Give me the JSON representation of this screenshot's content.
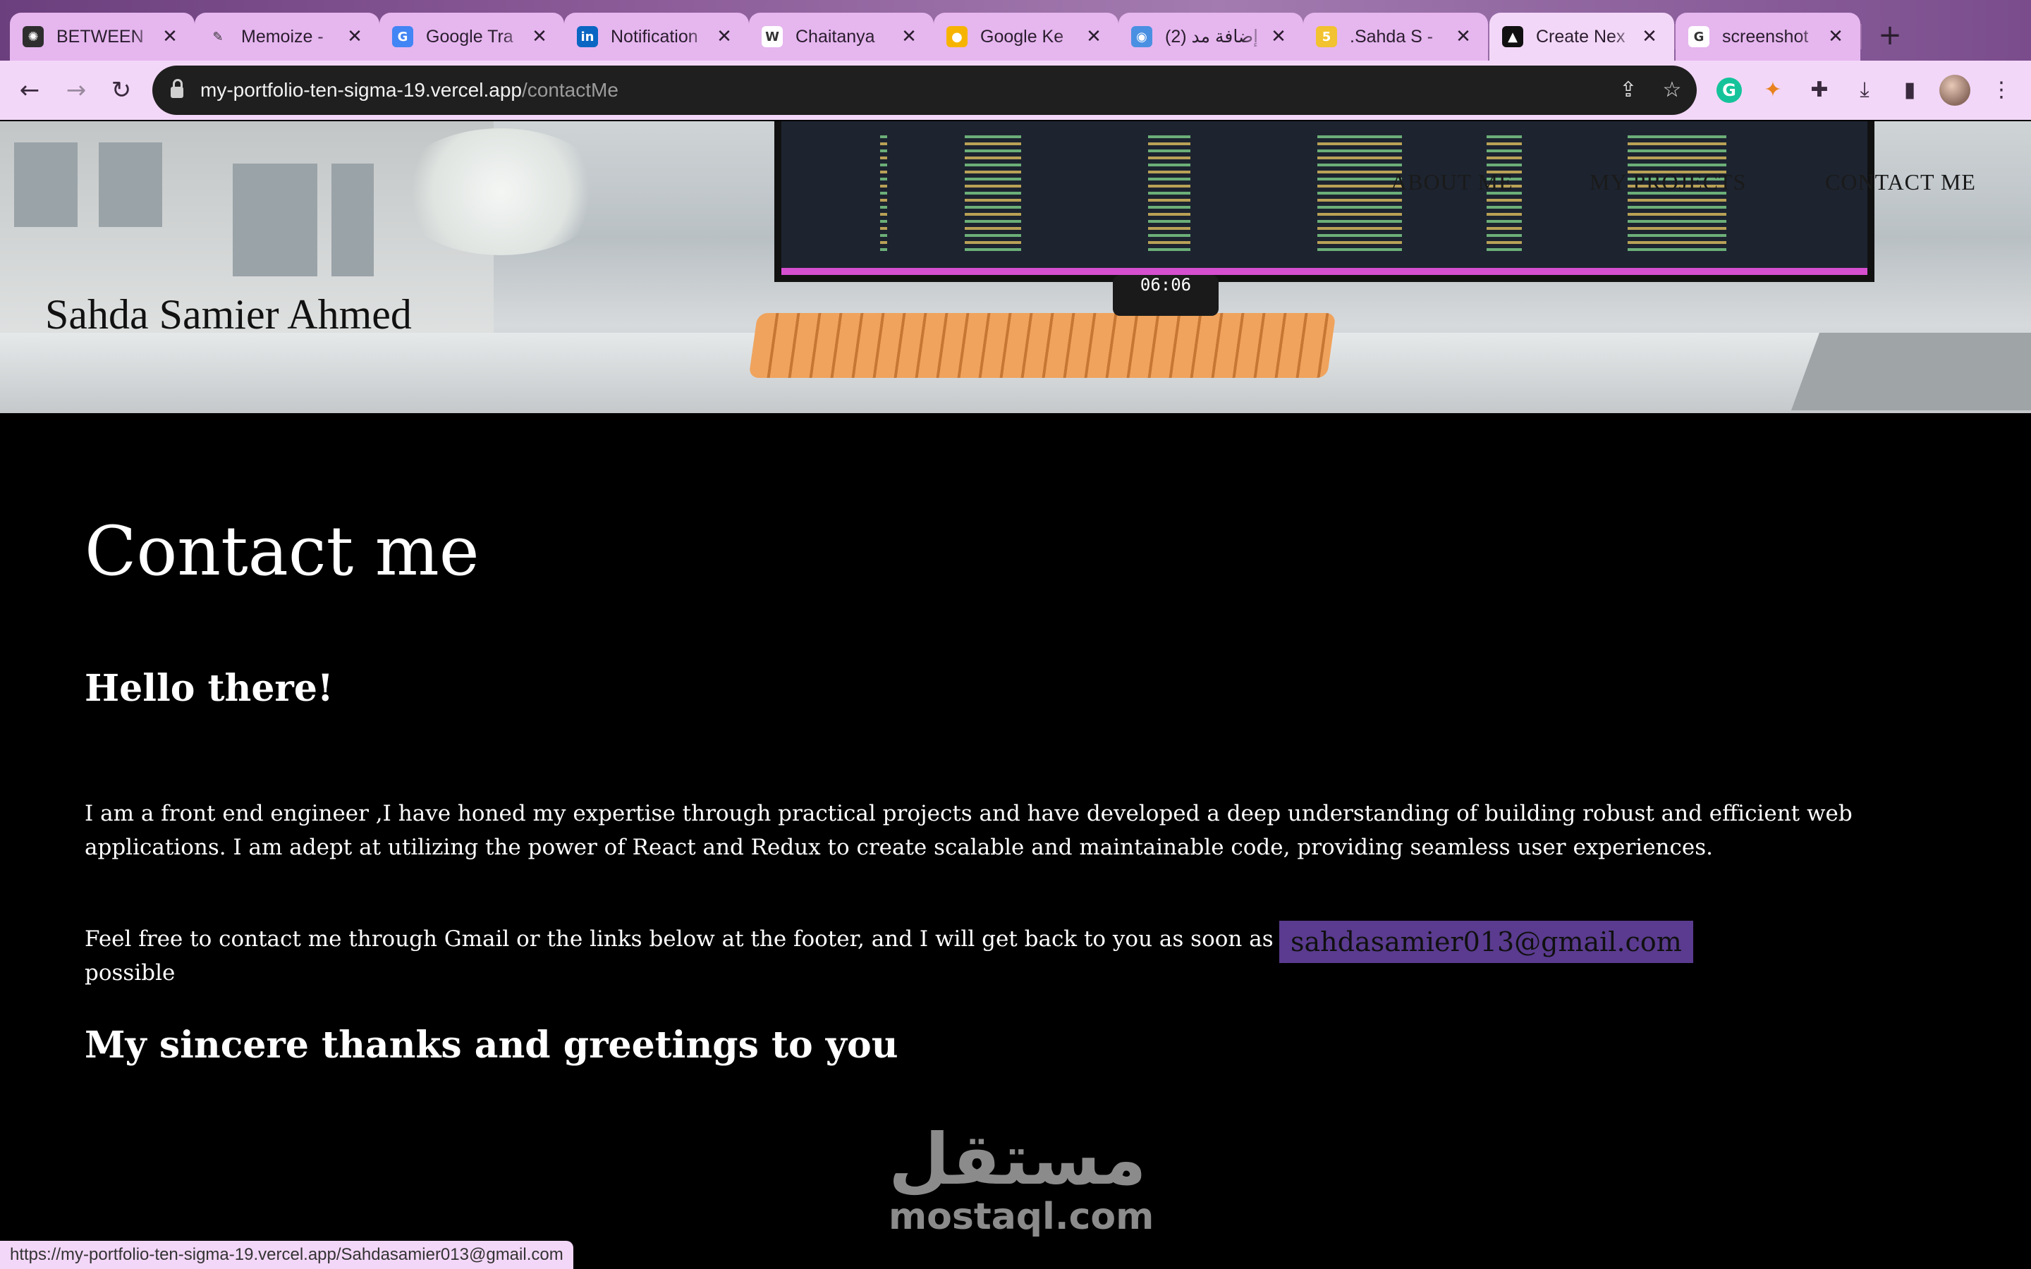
{
  "browser": {
    "tabs": [
      {
        "title": "BETWEEN",
        "favicon": "chatgpt-icon",
        "fav_color": "#2e2e2e",
        "fav_glyph": "✺"
      },
      {
        "title": "Memoize -",
        "favicon": "feather-icon",
        "fav_color": "#e6b6ef",
        "fav_glyph": "✎"
      },
      {
        "title": "Google Tra",
        "favicon": "google-translate-icon",
        "fav_color": "#4285f4",
        "fav_glyph": "G"
      },
      {
        "title": "Notification",
        "favicon": "linkedin-icon",
        "fav_color": "#0a66c2",
        "fav_glyph": "in"
      },
      {
        "title": "Chaitanya",
        "favicon": "wix-icon",
        "fav_color": "#ffffff",
        "fav_glyph": "W"
      },
      {
        "title": "Google Ke",
        "favicon": "google-keep-icon",
        "fav_color": "#f6b400",
        "fav_glyph": "●"
      },
      {
        "title": "(2) إضافة مد",
        "favicon": "mostaql-icon",
        "fav_color": "#4a90e2",
        "fav_glyph": "◉"
      },
      {
        "title": ".Sahda S -",
        "favicon": "number-five-icon",
        "fav_color": "#f2c230",
        "fav_glyph": "5"
      },
      {
        "title": "Create Nex",
        "favicon": "vercel-icon",
        "fav_color": "#111111",
        "fav_glyph": "▲"
      },
      {
        "title": "screenshot",
        "favicon": "google-icon",
        "fav_color": "#ffffff",
        "fav_glyph": "G"
      }
    ],
    "active_tab_index": 8,
    "url_host": "my-portfolio-ten-sigma-19.vercel.app",
    "url_path": "/contactMe",
    "status_url": "https://my-portfolio-ten-sigma-19.vercel.app/Sahdasamier013@gmail.com"
  },
  "site": {
    "title": "Sahda Samier Ahmed",
    "nav": [
      "ABOUT ME",
      "MY PROJECTS",
      "CONTACT ME"
    ],
    "clock": "06:06"
  },
  "contact": {
    "heading": "Contact me",
    "greeting": "Hello there!",
    "about": "I am a front end engineer ,I have honed my expertise through practical projects and have developed a deep understanding of building robust and efficient web applications. I am adept at utilizing the power of React and Redux to create scalable and maintainable code, providing seamless user experiences.",
    "cta": "Feel free to contact me through Gmail or the links below at the footer, and I will get back to you as soon as possible",
    "email": "sahdasamier013@gmail.com",
    "thanks": "My sincere thanks and greetings to you"
  },
  "watermark": {
    "arabic": "مستقل",
    "latin": "mostaql.com"
  },
  "colors": {
    "email_bg": "#5a3b8f",
    "tab_bg": "#e6b6ef",
    "page_bg": "#000000"
  }
}
